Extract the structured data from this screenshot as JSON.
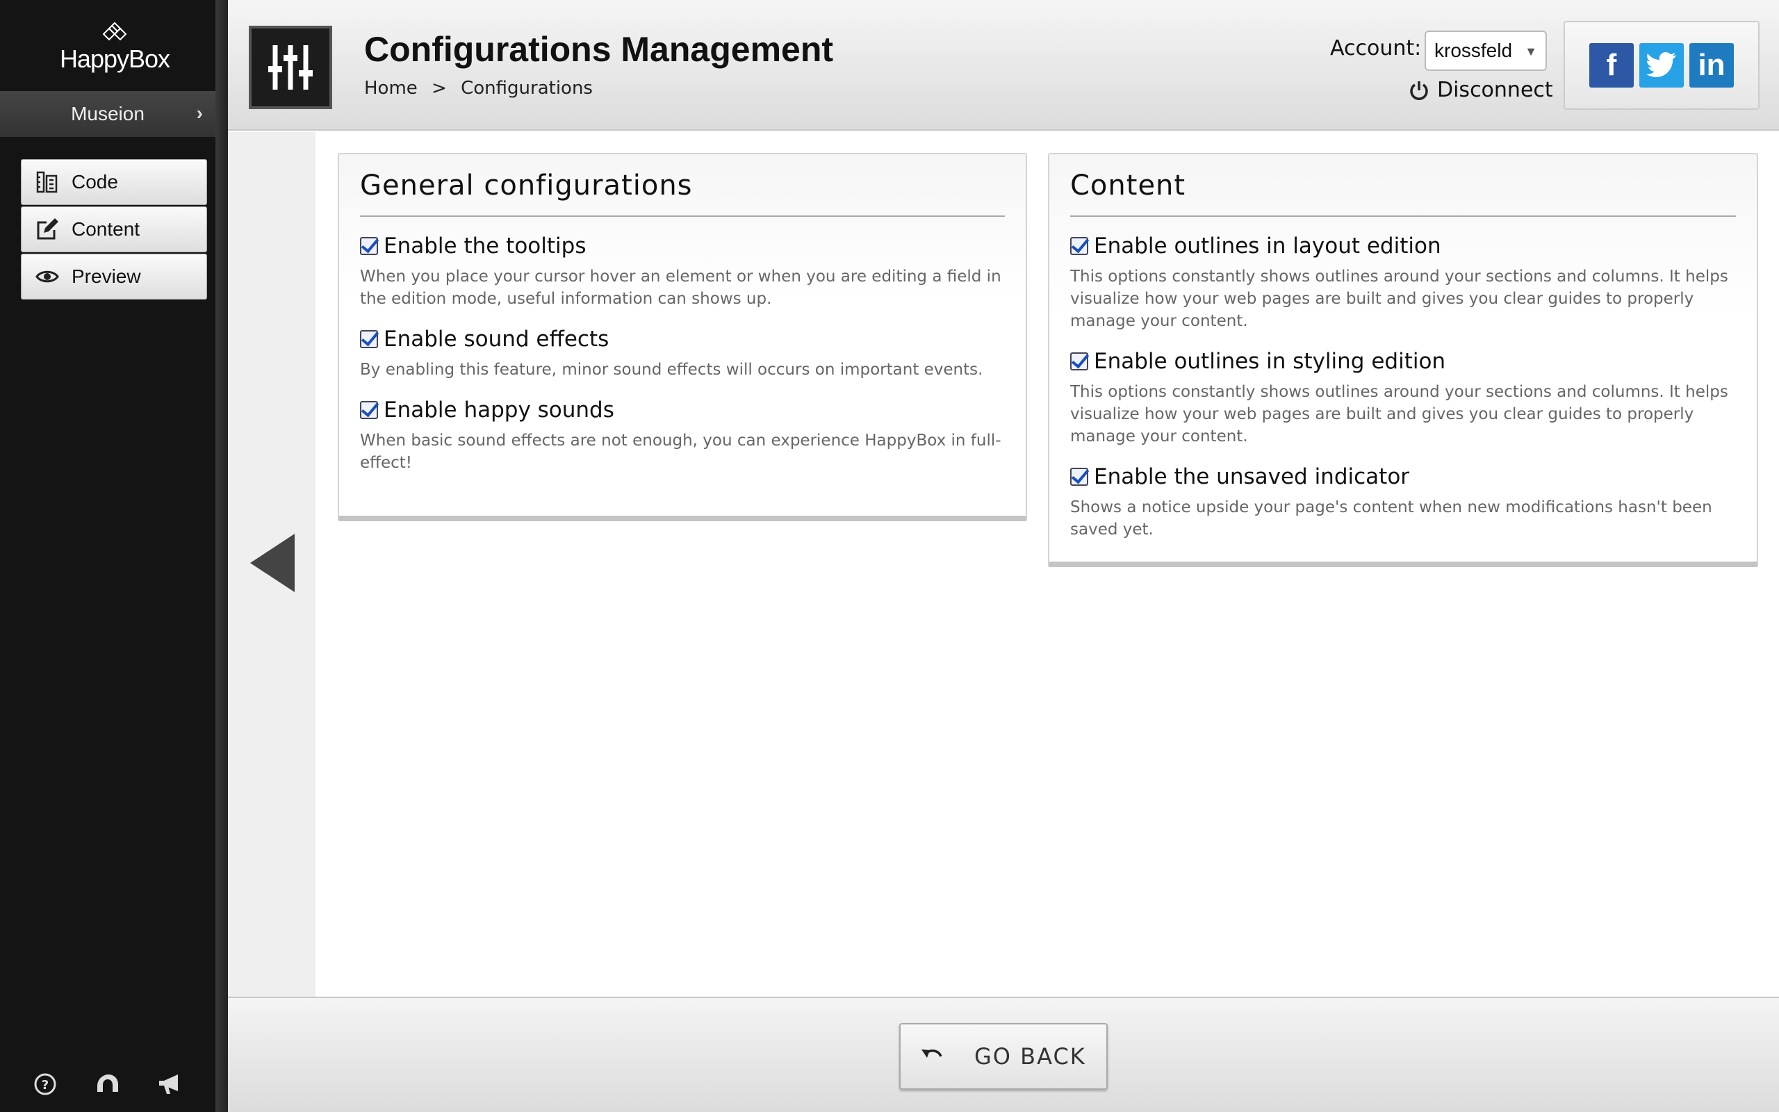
{
  "sidebar": {
    "logo_text": "HappyBox",
    "project_name": "Museion",
    "nav": [
      {
        "label": "Code",
        "icon": "code-ruler-icon"
      },
      {
        "label": "Content",
        "icon": "edit-icon"
      },
      {
        "label": "Preview",
        "icon": "eye-icon"
      }
    ],
    "footer_icons": [
      "help-icon",
      "support-icon",
      "announcement-icon"
    ]
  },
  "header": {
    "title": "Configurations Management",
    "breadcrumb": [
      "Home",
      ">",
      "Configurations"
    ],
    "account_label": "Account:",
    "account_value": "krossfeld",
    "disconnect_label": "Disconnect",
    "social": [
      "facebook-icon",
      "twitter-icon",
      "linkedin-icon"
    ]
  },
  "panels": [
    {
      "title": "General configurations",
      "options": [
        {
          "label": "Enable the tooltips",
          "checked": true,
          "description": "When you place your cursor hover an element or when you are editing a field in the edition mode, useful information can shows up."
        },
        {
          "label": "Enable sound effects",
          "checked": true,
          "description": "By enabling this feature, minor sound effects will occurs on important events."
        },
        {
          "label": "Enable happy sounds",
          "checked": true,
          "description": "When basic sound effects are not enough, you can experience HappyBox in full-effect!"
        }
      ]
    },
    {
      "title": "Content",
      "options": [
        {
          "label": "Enable outlines in layout edition",
          "checked": true,
          "description": "This options constantly shows outlines around your sections and columns. It helps visualize how your web pages are built and gives you clear guides to properly manage your content."
        },
        {
          "label": "Enable outlines in styling edition",
          "checked": true,
          "description": "This options constantly shows outlines around your sections and columns. It helps visualize how your web pages are built and gives you clear guides to properly manage your content."
        },
        {
          "label": "Enable the unsaved indicator",
          "checked": true,
          "description": "Shows a notice upside your page's content when new modifications hasn't been saved yet."
        }
      ]
    }
  ],
  "footer": {
    "go_back_label": "GO BACK"
  },
  "colors": {
    "sidebar_bg": "#141414",
    "facebook": "#2c58a5",
    "twitter": "#28a2e6",
    "linkedin": "#1f7bbf"
  }
}
